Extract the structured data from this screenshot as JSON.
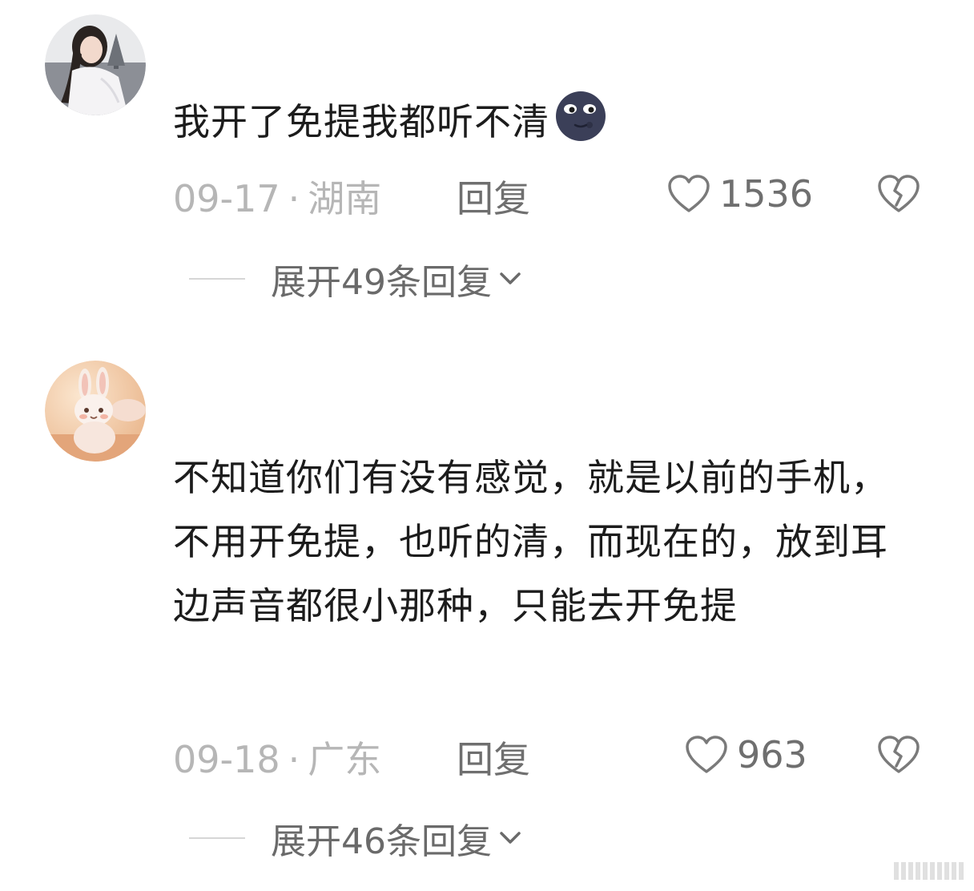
{
  "comments": [
    {
      "text": "我开了免提我都听不清",
      "emoji": "moon-face-emoji",
      "date": "09-17",
      "location": "湖南",
      "reply_label": "回复",
      "likes": "1536",
      "expand_label": "展开49条回复"
    },
    {
      "text": "不知道你们有没有感觉，就是以前的手机，不用开免提，也听的清，而现在的，放到耳边声音都很小那种，只能去开免提",
      "date": "09-18",
      "location": "广东",
      "reply_label": "回复",
      "likes": "963",
      "expand_label": "展开46条回复"
    }
  ],
  "separator": "·",
  "colors": {
    "text": "#1c1c1c",
    "meta_muted": "#b6b6b6",
    "meta_action": "#6f6f6f",
    "background": "#ffffff"
  },
  "icons": {
    "like": "heart-outline-icon",
    "dislike": "broken-heart-icon",
    "expand": "chevron-down-icon"
  }
}
